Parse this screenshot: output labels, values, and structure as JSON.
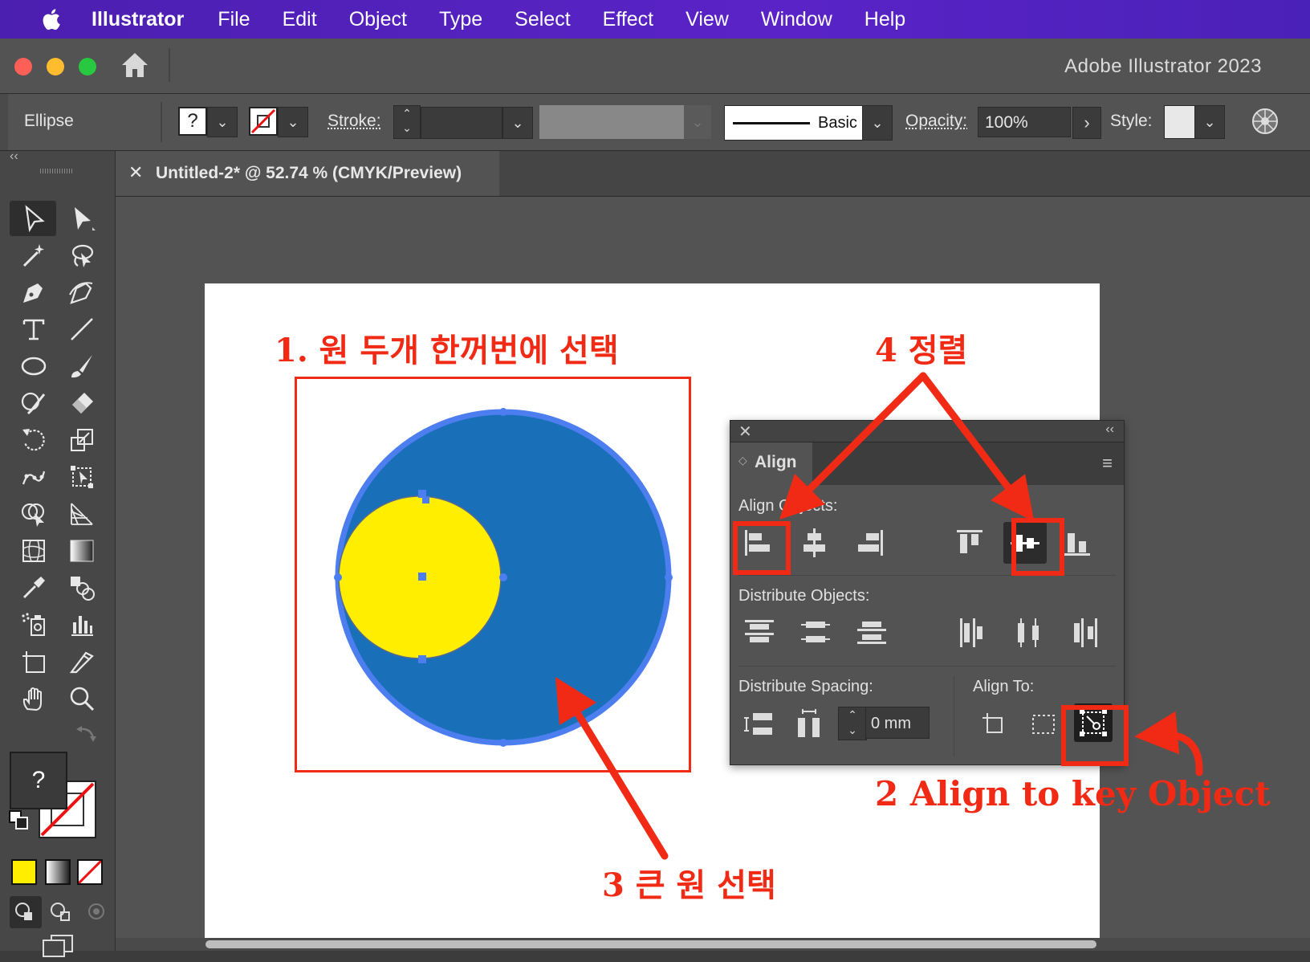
{
  "menubar": {
    "app": "Illustrator",
    "items": [
      "File",
      "Edit",
      "Object",
      "Type",
      "Select",
      "Effect",
      "View",
      "Window",
      "Help"
    ]
  },
  "window": {
    "title": "Adobe Illustrator 2023"
  },
  "controlbar": {
    "selection": "Ellipse",
    "fill_value": "?",
    "stroke_label": "Stroke:",
    "brush_label": "Basic",
    "opacity_label": "Opacity:",
    "opacity_value": "100%",
    "style_label": "Style:"
  },
  "document": {
    "tab_title": "Untitled-2* @ 52.74 % (CMYK/Preview)"
  },
  "tools_panel": {
    "fill_value": "?"
  },
  "align_panel": {
    "title": "Align",
    "align_objects_label": "Align Objects:",
    "distribute_objects_label": "Distribute Objects:",
    "distribute_spacing_label": "Distribute Spacing:",
    "align_to_label": "Align To:",
    "spacing_value": "0 mm"
  },
  "annotations": {
    "step1": "1. 원 두개 한꺼번에 선택",
    "step2": "2 Align to key Object",
    "step3": "3 큰 원 선택",
    "step4": "4 정렬"
  },
  "colors": {
    "annotation_red": "#f02a14",
    "big_circle": "#1a70b8",
    "big_circle_stroke": "#4c7ef0",
    "small_circle": "#ffee00"
  }
}
